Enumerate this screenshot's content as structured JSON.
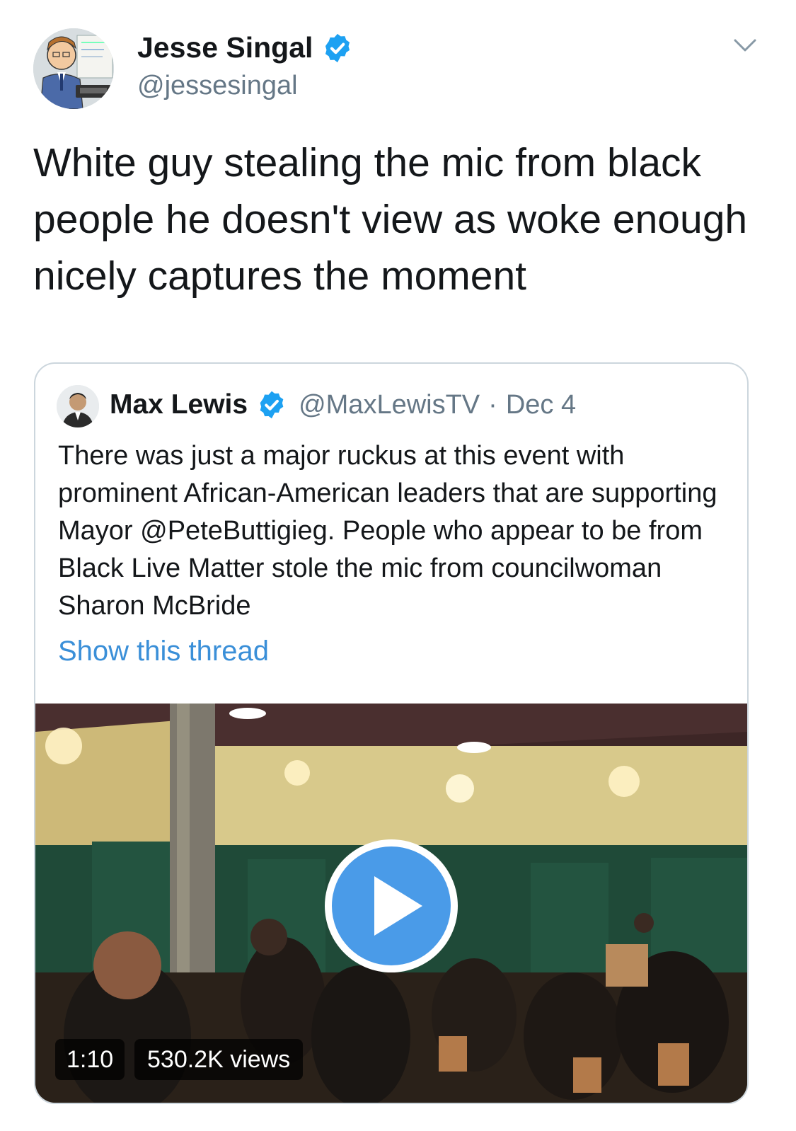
{
  "author": {
    "display_name": "Jesse Singal",
    "handle": "@jessesingal",
    "verified": true,
    "avatar_icon": "cartoon-avatar"
  },
  "tweet": {
    "text": "White guy stealing the mic from black people he doesn't view as woke enough nicely captures the moment"
  },
  "menu": {
    "icon": "chevron-down-icon"
  },
  "quoted_tweet": {
    "display_name": "Max Lewis",
    "handle": "@MaxLewisTV",
    "separator": "·",
    "date": "Dec 4",
    "verified": true,
    "text": "There was just a major ruckus at this event with prominent African-American leaders that are supporting Mayor @PeteButtigieg. People who appear to be from Black Live Matter stole the mic from councilwoman Sharon McBride",
    "show_thread_label": "Show this thread",
    "video": {
      "duration": "1:10",
      "views": "530.2K views",
      "play_icon": "play-icon"
    }
  },
  "colors": {
    "verified_blue": "#1da1f2",
    "link_blue": "#3a8fd8",
    "secondary_text": "#657786",
    "border": "#ccd6dd",
    "play_blue": "#4a9be8"
  }
}
